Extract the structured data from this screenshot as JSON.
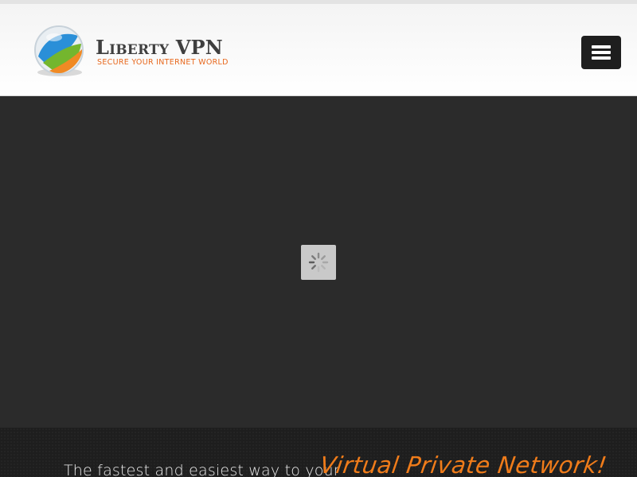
{
  "brand": {
    "name": "Liberty VPN",
    "tagline": "SECURE YOUR INTERNET WORLD",
    "name_color": "#3f3f3f",
    "tagline_color": "#e8681d"
  },
  "nav": {
    "menu_icon": "hamburger-menu-icon"
  },
  "slider": {
    "loading_icon": "spinner-icon"
  },
  "hero": {
    "text_plain": "The fastest and easiest way to your",
    "text_accent": "Virtual Private Network!",
    "accent_color": "#f07c1a"
  }
}
